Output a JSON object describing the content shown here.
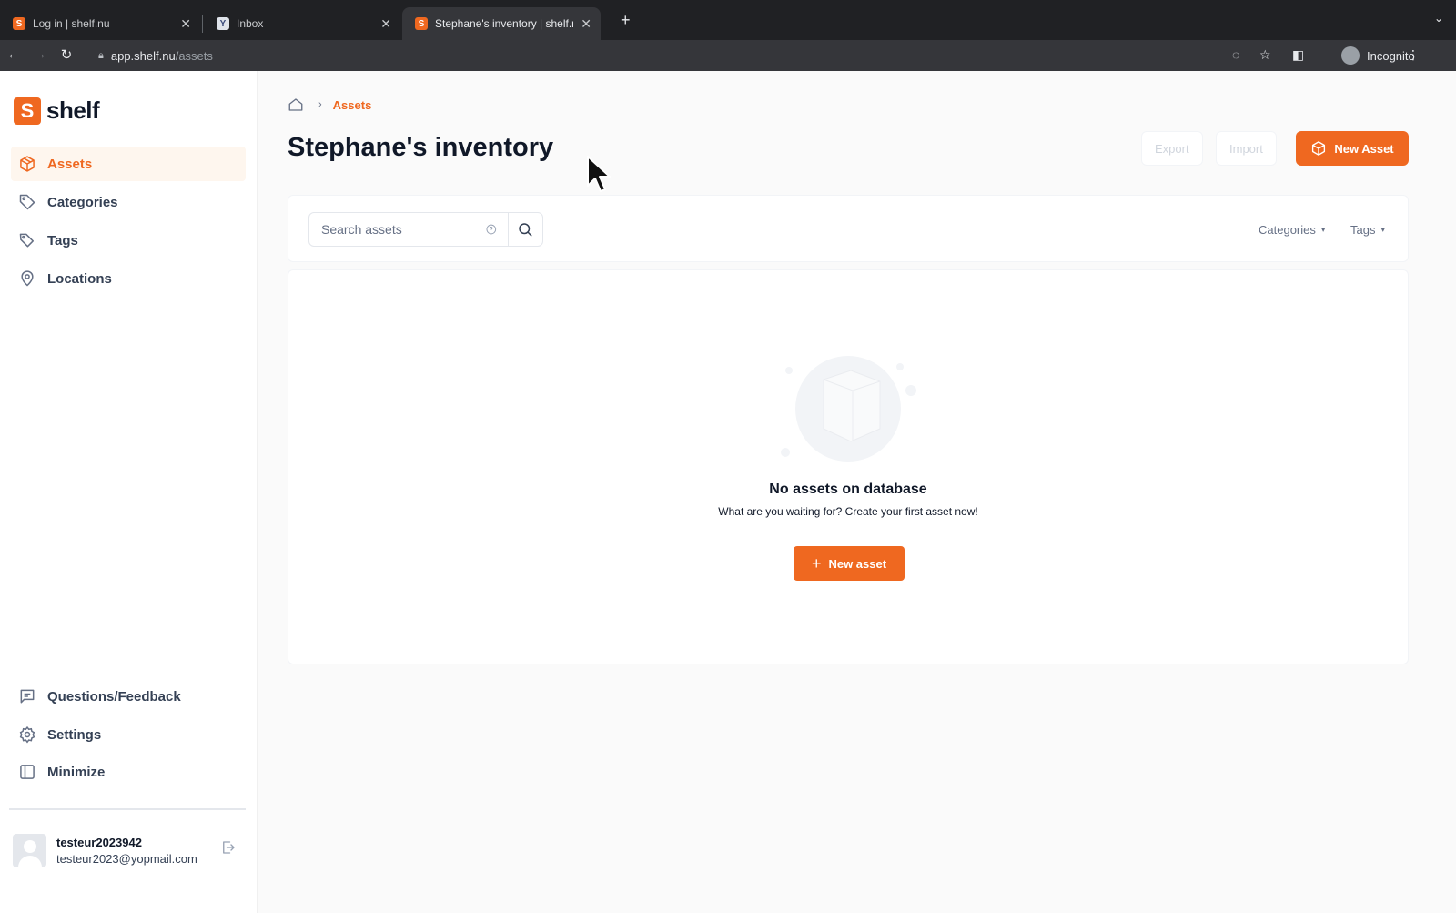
{
  "browser": {
    "tabs": [
      {
        "title": "Log in | shelf.nu",
        "favicon": "shelf-favicon",
        "active": false
      },
      {
        "title": "Inbox",
        "favicon": "yopmail-favicon",
        "active": false
      },
      {
        "title": "Stephane's inventory | shelf.nu",
        "favicon": "shelf-favicon",
        "active": true
      }
    ],
    "url_host": "app.shelf.nu",
    "url_path": "/assets",
    "profile_label": "Incognito"
  },
  "sidebar": {
    "logo_mark": "S",
    "logo_text": "shelf",
    "items": [
      {
        "label": "Assets",
        "icon": "cube-icon",
        "active": true
      },
      {
        "label": "Categories",
        "icon": "tag-icon"
      },
      {
        "label": "Tags",
        "icon": "tags-icon"
      },
      {
        "label": "Locations",
        "icon": "map-pin-icon"
      }
    ],
    "bottom_items": [
      {
        "label": "Questions/Feedback",
        "icon": "message-icon"
      },
      {
        "label": "Settings",
        "icon": "gear-icon"
      },
      {
        "label": "Minimize",
        "icon": "sidebar-icon"
      }
    ],
    "user": {
      "name": "testeur2023942",
      "email": "testeur2023@yopmail.com"
    }
  },
  "main": {
    "breadcrumb": {
      "current": "Assets"
    },
    "title": "Stephane's inventory",
    "actions": {
      "export": "Export",
      "import": "Import",
      "new_asset": "New Asset"
    },
    "filters": {
      "search_placeholder": "Search assets",
      "categories": "Categories",
      "tags": "Tags"
    },
    "empty_state": {
      "title": "No assets on database",
      "subtitle": "What are you waiting for? Create your first asset now!",
      "button": "New asset"
    }
  },
  "colors": {
    "accent": "#ef6820",
    "active_bg": "#fef6ee",
    "text": "#101828"
  }
}
